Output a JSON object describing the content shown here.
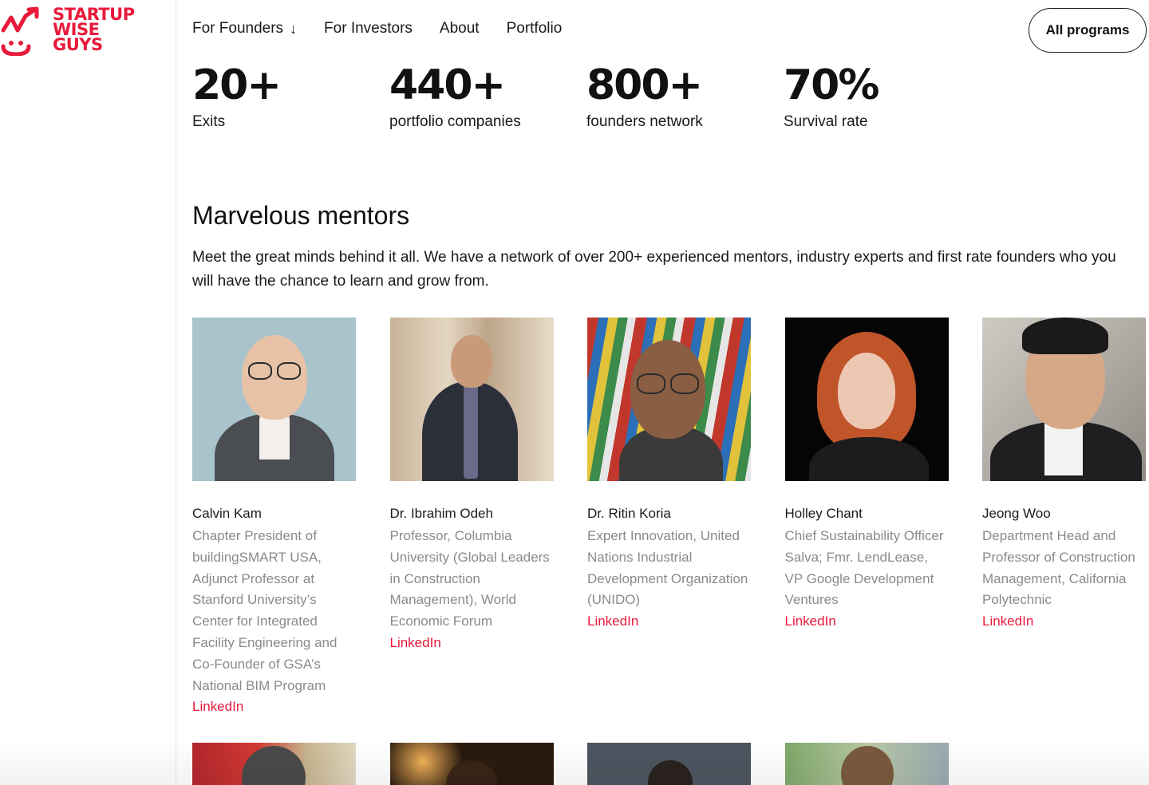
{
  "brand": {
    "line1": "STARTUP",
    "line2": "WISE",
    "line3": "GUYS",
    "color": "#e8193a"
  },
  "nav": {
    "items": [
      {
        "label": "For Founders",
        "has_arrow": true
      },
      {
        "label": "For Investors"
      },
      {
        "label": "About"
      },
      {
        "label": "Portfolio"
      }
    ],
    "cta": "All programs"
  },
  "stats": [
    {
      "value": "20+",
      "label": "Exits"
    },
    {
      "value": "440+",
      "label": "portfolio companies"
    },
    {
      "value": "800+",
      "label": "founders network"
    },
    {
      "value": "70%",
      "label": "Survival rate"
    }
  ],
  "mentors": {
    "title": "Marvelous mentors",
    "description": "Meet the great minds behind it all. We have a network of over 200+ experienced mentors, industry experts and first rate founders who you will have the chance to learn and grow from.",
    "link_label": "LinkedIn",
    "cards": [
      {
        "name": "Calvin Kam",
        "role": "Chapter President of buildingSMART USA, Adjunct Professor at Stanford University’s Center for Integrated Facility Engineering and Co-Founder of GSA’s National BIM Program",
        "link": "LinkedIn"
      },
      {
        "name": "Dr. Ibrahim Odeh",
        "role": "Professor, Columbia University (Global Leaders in Construction Management), World Economic Forum",
        "link": "LinkedIn"
      },
      {
        "name": "Dr. Ritin Koria",
        "role": "Expert Innovation, United Nations Industrial Development Organization (UNIDO)",
        "link": "LinkedIn"
      },
      {
        "name": "Holley Chant",
        "role": "Chief Sustainability Officer\nSalva; Fmr. LendLease, VP Google Development Ventures",
        "link": "LinkedIn"
      },
      {
        "name": "Jeong Woo",
        "role": "Department Head and Professor of Construction Management, California Polytechnic",
        "link": "LinkedIn"
      }
    ]
  }
}
